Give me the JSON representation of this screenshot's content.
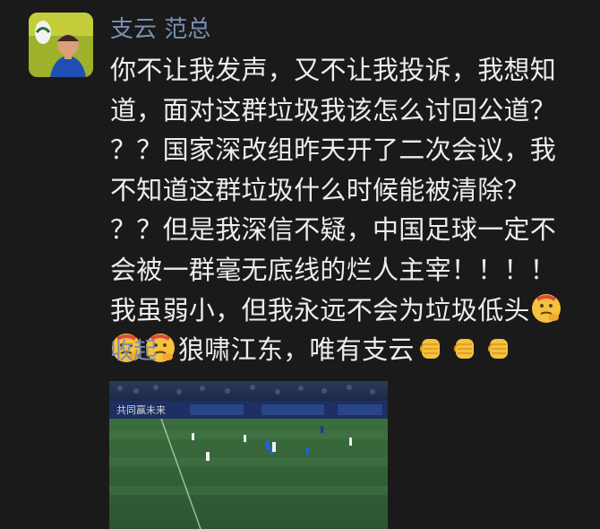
{
  "post": {
    "author": "支云 范总",
    "lines": [
      "你不让我发声，又不让我投诉，我想知",
      "道，面对这群垃圾我该怎么讨回公道？",
      "？？国家深改组昨天开了二次会议，我",
      "不知道这群垃圾什么时候能被清除？",
      "？？但是我深信不疑，中国足球一定不",
      "会被一群毫无底线的烂人主宰！！！！",
      "我虽弱小，但我永远不会为垃圾低头"
    ],
    "last_line_text": "狼啸江东，唯有支云",
    "emojis": {
      "thinking": "thinking-face-icon",
      "fist": "raised-fist-icon"
    },
    "collapse_label": "收起",
    "video_board_text": "共同赢未来"
  },
  "colors": {
    "background": "#1a1a1a",
    "text": "#ededed",
    "link": "#7b8fb3",
    "pitch": "#2f5c34"
  }
}
